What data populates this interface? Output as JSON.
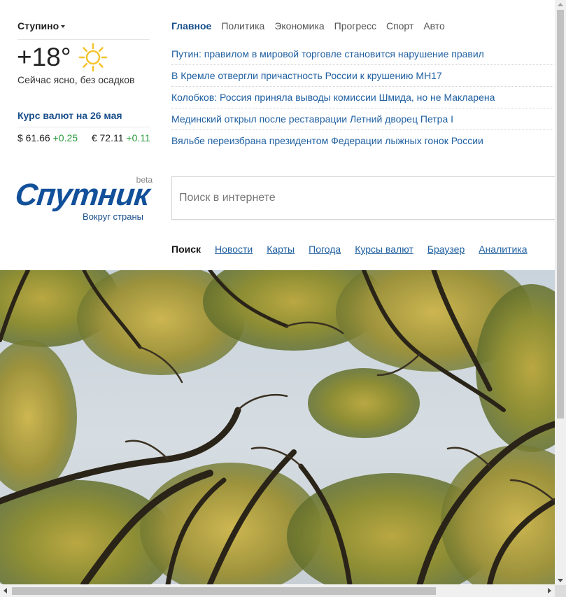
{
  "location": {
    "city": "Ступино"
  },
  "weather": {
    "temperature": "+18°",
    "description": "Сейчас ясно, без осадков",
    "icon": "sun-icon",
    "icon_color": "#f4c430"
  },
  "rates": {
    "title": "Курс валют на 26 мая",
    "usd": {
      "value": "$ 61.66",
      "change": "+0.25"
    },
    "eur": {
      "value": "€ 72.11",
      "change": "+0.11"
    },
    "positive_color": "#2a9a3a"
  },
  "tabs": [
    "Главное",
    "Политика",
    "Экономика",
    "Прогресс",
    "Спорт",
    "Авто"
  ],
  "active_tab": "Главное",
  "news": [
    "Путин: правилом в мировой торговле становится нарушение правил",
    "В Кремле отвергли причастность России к крушению МН17",
    "Колобков: Россия приняла выводы комиссии Шмида, но не Макларена",
    "Мединский открыл после реставрации Летний дворец Петра I",
    "Вяльбе переизбрана президентом Федерации лыжных гонок России"
  ],
  "logo": {
    "word": "Спутник",
    "badge": "beta",
    "tagline": "Вокруг страны",
    "color": "#12509a"
  },
  "search": {
    "placeholder": "Поиск в интернете",
    "value": ""
  },
  "services": [
    "Поиск",
    "Новости",
    "Карты",
    "Погода",
    "Курсы валют",
    "Браузер",
    "Аналитика"
  ],
  "active_service": "Поиск",
  "background": {
    "subject": "tree canopy against sky"
  }
}
